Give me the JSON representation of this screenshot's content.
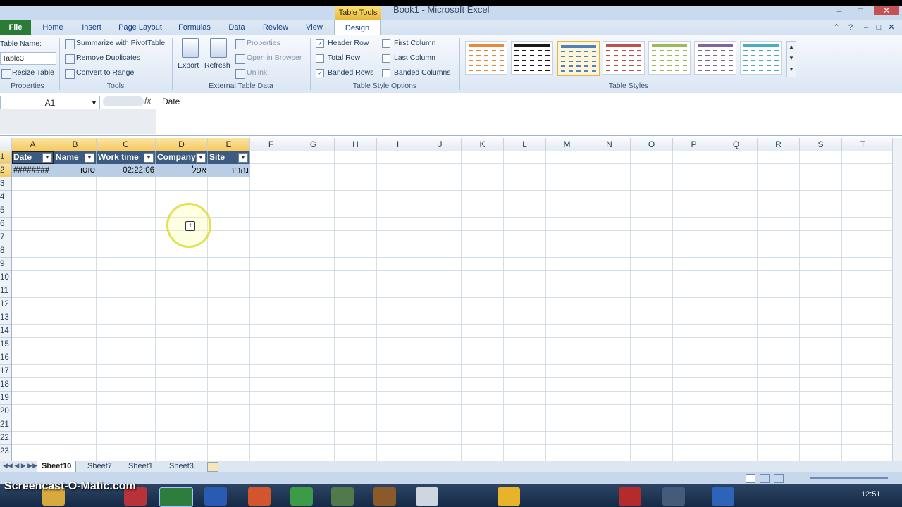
{
  "window": {
    "title": "Book1 - Microsoft Excel",
    "contextual_tab_group": "Table Tools"
  },
  "ribbon_tabs": [
    "File",
    "Home",
    "Insert",
    "Page Layout",
    "Formulas",
    "Data",
    "Review",
    "View",
    "Design"
  ],
  "active_tab": "Design",
  "properties_group": {
    "table_name_label": "Table Name:",
    "table_name_value": "Table3",
    "resize_table": "Resize Table",
    "label": "Properties"
  },
  "tools_group": {
    "summarize": "Summarize with PivotTable",
    "remove_duplicates": "Remove Duplicates",
    "convert_to_range": "Convert to Range",
    "label": "Tools"
  },
  "external_group": {
    "export": "Export",
    "refresh": "Refresh",
    "properties": "Properties",
    "open_in_browser": "Open in Browser",
    "unlink": "Unlink",
    "label": "External Table Data"
  },
  "style_options_group": {
    "header_row": {
      "label": "Header Row",
      "checked": true
    },
    "total_row": {
      "label": "Total Row",
      "checked": false
    },
    "banded_rows": {
      "label": "Banded Rows",
      "checked": true
    },
    "first_column": {
      "label": "First Column",
      "checked": false
    },
    "last_column": {
      "label": "Last Column",
      "checked": false
    },
    "banded_columns": {
      "label": "Banded Columns",
      "checked": false
    },
    "label": "Table Style Options"
  },
  "table_styles_group": {
    "label": "Table Styles",
    "swatch_colors": [
      "#e8883a",
      "#1a1a1a",
      "#4f81bd",
      "#c0504d",
      "#9bbb59",
      "#8064a2",
      "#4bacc6"
    ],
    "selected_index": 2
  },
  "formula_bar": {
    "name_box": "A1",
    "fx": "fx",
    "content": "Date"
  },
  "columns": [
    "A",
    "B",
    "C",
    "D",
    "E",
    "F",
    "G",
    "H",
    "I",
    "J",
    "K",
    "L",
    "M",
    "N",
    "O",
    "P",
    "Q",
    "R",
    "S",
    "T"
  ],
  "rows": [
    "1",
    "2",
    "3",
    "4",
    "5",
    "6",
    "7",
    "8",
    "9",
    "10",
    "11",
    "12",
    "13",
    "14",
    "15",
    "16",
    "17",
    "18",
    "19",
    "20",
    "21",
    "22",
    "23"
  ],
  "table": {
    "headers": [
      "Date",
      "Name",
      "Work time",
      "Company",
      "Site"
    ],
    "row": [
      "########",
      "סוסו",
      "02:22:06",
      "אפל",
      "נהריה"
    ]
  },
  "sheet_tabs": [
    "Sheet10",
    "Sheet7",
    "Sheet1",
    "Sheet3"
  ],
  "active_sheet": "Sheet10",
  "watermark": "Screencast-O-Matic.com",
  "clock": "12:51"
}
